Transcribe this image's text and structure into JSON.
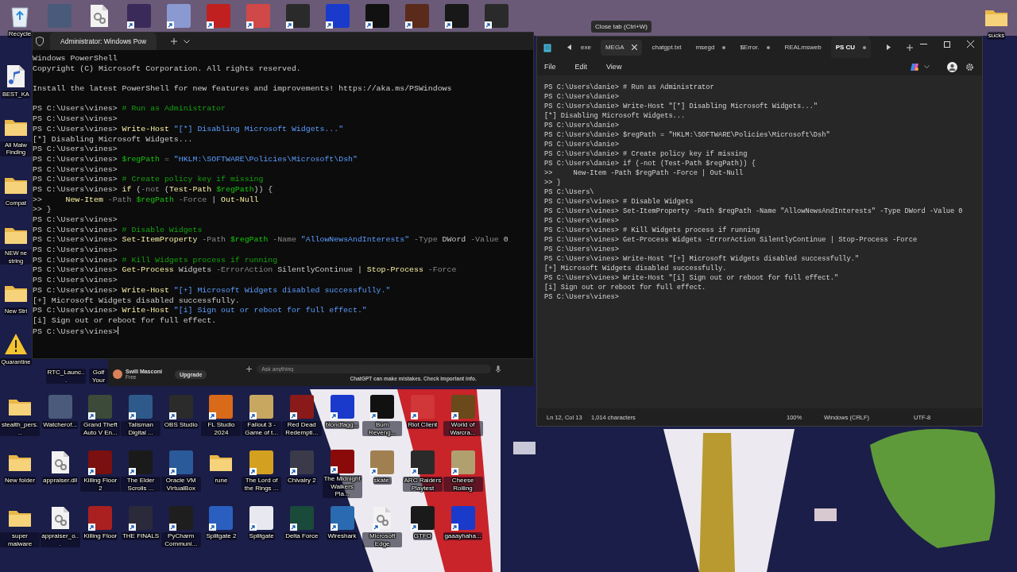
{
  "desktop": {
    "top_row": [
      {
        "label": "Recycle",
        "kind": "recycle"
      },
      {
        "kind": "app",
        "color": "#4a5a7a"
      },
      {
        "kind": "file"
      },
      {
        "kind": "app",
        "shortcut": true,
        "color": "#3a2a5a"
      },
      {
        "kind": "app",
        "shortcut": true,
        "color": "#8a9ad0"
      },
      {
        "kind": "app",
        "shortcut": true,
        "color": "#c02020"
      },
      {
        "kind": "app",
        "shortcut": true,
        "color": "#d04848"
      },
      {
        "kind": "app",
        "shortcut": true,
        "color": "#2a2a2a"
      },
      {
        "kind": "app",
        "shortcut": true,
        "color": "#1a3acc"
      },
      {
        "kind": "app",
        "shortcut": true,
        "color": "#111111"
      },
      {
        "kind": "app",
        "shortcut": true,
        "color": "#5a2a1a"
      },
      {
        "kind": "app",
        "shortcut": true,
        "color": "#181818"
      },
      {
        "kind": "app",
        "shortcut": true,
        "color": "#2a2a2a"
      }
    ],
    "left_column": [
      {
        "label": "BEST_KA",
        "kind": "music"
      },
      {
        "label": "All Malw Finding",
        "kind": "folder"
      },
      {
        "label": "Compat",
        "kind": "folder"
      },
      {
        "label": "NEW ne string",
        "kind": "folder"
      },
      {
        "label": "New Stri",
        "kind": "folder"
      },
      {
        "label": "Quarantine",
        "kind": "warning"
      }
    ],
    "partial_labels": [
      "RTC_Launc...",
      "Golf Your"
    ],
    "right_column": [
      {
        "label": "sucks",
        "kind": "folder"
      }
    ],
    "grid": [
      {
        "label": "stealth_pers...",
        "kind": "folder"
      },
      {
        "label": "Watcherof...",
        "kind": "app",
        "color": "#4a5a7a"
      },
      {
        "label": "Grand Theft Auto V En...",
        "kind": "app",
        "shortcut": true,
        "color": "#3c4a3a"
      },
      {
        "label": "Talisman Digital ...",
        "kind": "app",
        "shortcut": true,
        "color": "#2d5a8a"
      },
      {
        "label": "OBS Studio",
        "kind": "app",
        "shortcut": true,
        "color": "#2b2b2b"
      },
      {
        "label": "FL Studio 2024",
        "kind": "app",
        "shortcut": true,
        "color": "#d96a1a"
      },
      {
        "label": "Fallout 3 - Game of t...",
        "kind": "app",
        "shortcut": true,
        "color": "#c8a860"
      },
      {
        "label": "Red Dead Redempti...",
        "kind": "app",
        "shortcut": true,
        "color": "#8a1a1a"
      },
      {
        "label": "blondfagg...",
        "kind": "app",
        "shortcut": true,
        "color": "#1a3acc"
      },
      {
        "label": "Bum Reveng...",
        "kind": "app",
        "shortcut": true,
        "color": "#111111"
      },
      {
        "label": "Riot Client",
        "kind": "app",
        "shortcut": true,
        "color": "#d13639"
      },
      {
        "label": "World of Warcra...",
        "kind": "app",
        "shortcut": true,
        "color": "#6a4a1a"
      },
      {
        "label": "New folder",
        "kind": "folder"
      },
      {
        "label": "appraiser.dll",
        "kind": "file"
      },
      {
        "label": "Killing Floor 2",
        "kind": "app",
        "shortcut": true,
        "color": "#7a1010"
      },
      {
        "label": "The Elder Scrolls ...",
        "kind": "app",
        "shortcut": true,
        "color": "#1a1a1a"
      },
      {
        "label": "Oracle VM VirtualBox",
        "kind": "app",
        "shortcut": true,
        "color": "#2a5a9a"
      },
      {
        "label": "rune",
        "kind": "folder"
      },
      {
        "label": "The Lord of the Rings ...",
        "kind": "app",
        "shortcut": true,
        "color": "#d4a020"
      },
      {
        "label": "Chivalry 2",
        "kind": "app",
        "shortcut": true,
        "color": "#3a3a4a"
      },
      {
        "label": "The Midnight Walkers Pla...",
        "kind": "app",
        "shortcut": true,
        "color": "#8a0a0a"
      },
      {
        "label": "skate.",
        "kind": "app",
        "shortcut": true,
        "color": "#a08050"
      },
      {
        "label": "ARC Raiders Playtest",
        "kind": "app",
        "shortcut": true,
        "color": "#2a2a2a"
      },
      {
        "label": "Cheese Rolling",
        "kind": "app",
        "shortcut": true,
        "color": "#b0a070"
      },
      {
        "label": "super malware",
        "kind": "folder"
      },
      {
        "label": "appraiser_o...",
        "kind": "file"
      },
      {
        "label": "Killing Floor",
        "kind": "app",
        "shortcut": true,
        "color": "#aa2020"
      },
      {
        "label": "THE FINALS",
        "kind": "app",
        "shortcut": true,
        "color": "#2a2a3a"
      },
      {
        "label": "PyCharm Communi...",
        "kind": "app",
        "shortcut": true,
        "color": "#1e1e1e"
      },
      {
        "label": "Splitgate 2",
        "kind": "app",
        "shortcut": true,
        "color": "#2a5fc0"
      },
      {
        "label": "Splitgate",
        "kind": "app",
        "shortcut": true,
        "color": "#e8e8f0"
      },
      {
        "label": "Delta Force",
        "kind": "app",
        "shortcut": true,
        "color": "#1a4a3a"
      },
      {
        "label": "Wireshark",
        "kind": "app",
        "shortcut": true,
        "color": "#2a6ab0"
      },
      {
        "label": "Microsoft Edge",
        "kind": "file",
        "shortcut": true
      },
      {
        "label": "GTFO",
        "kind": "app",
        "shortcut": true,
        "color": "#1a1a1a"
      },
      {
        "label": "gaaayhaha...",
        "kind": "app",
        "shortcut": true,
        "color": "#1a3acc"
      }
    ]
  },
  "terminal": {
    "tab_title": "Administrator: Windows Pow",
    "cursor": true,
    "lines": [
      {
        "kind": "code",
        "segments": [
          {
            "kind": "text",
            "text": "Windows PowerShell"
          }
        ]
      },
      {
        "kind": "code",
        "segments": [
          {
            "kind": "text",
            "text": "Copyright (C) Microsoft Corporation. All rights reserved."
          }
        ]
      },
      {
        "kind": "blank"
      },
      {
        "kind": "code",
        "segments": [
          {
            "kind": "text",
            "text": "Install the latest PowerShell for new features and improvements! https://aka.ms/PSWindows"
          }
        ]
      },
      {
        "kind": "blank"
      },
      {
        "kind": "code",
        "segments": [
          {
            "kind": "prompt",
            "text": "PS C:\\Users\\vines> "
          },
          {
            "kind": "comment",
            "text": "# Run as Administrator"
          }
        ]
      },
      {
        "kind": "code",
        "segments": [
          {
            "kind": "prompt",
            "text": "PS C:\\Users\\vines>"
          }
        ]
      },
      {
        "kind": "code",
        "segments": [
          {
            "kind": "prompt",
            "text": "PS C:\\Users\\vines> "
          },
          {
            "kind": "cmd",
            "text": "Write-Host"
          },
          {
            "kind": "string",
            "text": " \"[*] Disabling Microsoft Widgets...\""
          }
        ]
      },
      {
        "kind": "code",
        "segments": [
          {
            "kind": "text",
            "text": "[*] Disabling Microsoft Widgets..."
          }
        ]
      },
      {
        "kind": "code",
        "segments": [
          {
            "kind": "prompt",
            "text": "PS C:\\Users\\vines>"
          }
        ]
      },
      {
        "kind": "code",
        "segments": [
          {
            "kind": "prompt",
            "text": "PS C:\\Users\\vines> "
          },
          {
            "kind": "var",
            "text": "$regPath"
          },
          {
            "kind": "param",
            "text": " = "
          },
          {
            "kind": "string",
            "text": "\"HKLM:\\SOFTWARE\\Policies\\Microsoft\\Dsh\""
          }
        ]
      },
      {
        "kind": "code",
        "segments": [
          {
            "kind": "prompt",
            "text": "PS C:\\Users\\vines>"
          }
        ]
      },
      {
        "kind": "code",
        "segments": [
          {
            "kind": "prompt",
            "text": "PS C:\\Users\\vines> "
          },
          {
            "kind": "comment",
            "text": "# Create policy key if missing"
          }
        ]
      },
      {
        "kind": "code",
        "segments": [
          {
            "kind": "prompt",
            "text": "PS C:\\Users\\vines> "
          },
          {
            "kind": "cmd",
            "text": "if"
          },
          {
            "kind": "text",
            "text": " ("
          },
          {
            "kind": "param",
            "text": "-not"
          },
          {
            "kind": "text",
            "text": " ("
          },
          {
            "kind": "cmd",
            "text": "Test-Path"
          },
          {
            "kind": "var",
            "text": " $regPath"
          },
          {
            "kind": "text",
            "text": ")) {"
          }
        ]
      },
      {
        "kind": "code",
        "segments": [
          {
            "kind": "text",
            "text": ">>     "
          },
          {
            "kind": "cmd",
            "text": "New-Item"
          },
          {
            "kind": "param",
            "text": " -Path"
          },
          {
            "kind": "var",
            "text": " $regPath"
          },
          {
            "kind": "param",
            "text": " -Force"
          },
          {
            "kind": "text",
            "text": " | "
          },
          {
            "kind": "cmd",
            "text": "Out-Null"
          }
        ]
      },
      {
        "kind": "code",
        "segments": [
          {
            "kind": "text",
            "text": ">> }"
          }
        ]
      },
      {
        "kind": "code",
        "segments": [
          {
            "kind": "prompt",
            "text": "PS C:\\Users\\vines>"
          }
        ]
      },
      {
        "kind": "code",
        "segments": [
          {
            "kind": "prompt",
            "text": "PS C:\\Users\\vines> "
          },
          {
            "kind": "comment",
            "text": "# Disable Widgets"
          }
        ]
      },
      {
        "kind": "code",
        "segments": [
          {
            "kind": "prompt",
            "text": "PS C:\\Users\\vines> "
          },
          {
            "kind": "cmd",
            "text": "Set-ItemProperty"
          },
          {
            "kind": "param",
            "text": " -Path"
          },
          {
            "kind": "var",
            "text": " $regPath"
          },
          {
            "kind": "param",
            "text": " -Name"
          },
          {
            "kind": "string",
            "text": " \"AllowNewsAndInterests\""
          },
          {
            "kind": "param",
            "text": " -Type"
          },
          {
            "kind": "text",
            "text": " DWord"
          },
          {
            "kind": "param",
            "text": " -Value"
          },
          {
            "kind": "text",
            "text": " 0"
          }
        ]
      },
      {
        "kind": "code",
        "segments": [
          {
            "kind": "prompt",
            "text": "PS C:\\Users\\vines>"
          }
        ]
      },
      {
        "kind": "code",
        "segments": [
          {
            "kind": "prompt",
            "text": "PS C:\\Users\\vines> "
          },
          {
            "kind": "comment",
            "text": "# Kill Widgets process if running"
          }
        ]
      },
      {
        "kind": "code",
        "segments": [
          {
            "kind": "prompt",
            "text": "PS C:\\Users\\vines> "
          },
          {
            "kind": "cmd",
            "text": "Get-Process"
          },
          {
            "kind": "text",
            "text": " Widgets "
          },
          {
            "kind": "param",
            "text": "-ErrorAction"
          },
          {
            "kind": "text",
            "text": " SilentlyContinue | "
          },
          {
            "kind": "cmd",
            "text": "Stop-Process"
          },
          {
            "kind": "param",
            "text": " -Force"
          }
        ]
      },
      {
        "kind": "code",
        "segments": [
          {
            "kind": "prompt",
            "text": "PS C:\\Users\\vines>"
          }
        ]
      },
      {
        "kind": "code",
        "segments": [
          {
            "kind": "prompt",
            "text": "PS C:\\Users\\vines> "
          },
          {
            "kind": "cmd",
            "text": "Write-Host"
          },
          {
            "kind": "string",
            "text": " \"[+] Microsoft Widgets disabled successfully.\""
          }
        ]
      },
      {
        "kind": "code",
        "segments": [
          {
            "kind": "text",
            "text": "[+] Microsoft Widgets disabled successfully."
          }
        ]
      },
      {
        "kind": "code",
        "segments": [
          {
            "kind": "prompt",
            "text": "PS C:\\Users\\vines> "
          },
          {
            "kind": "cmd",
            "text": "Write-Host"
          },
          {
            "kind": "string",
            "text": " \"[i] Sign out or reboot for full effect.\""
          }
        ]
      },
      {
        "kind": "code",
        "segments": [
          {
            "kind": "text",
            "text": "[i] Sign out or reboot for full effect."
          }
        ]
      },
      {
        "kind": "code",
        "segments": [
          {
            "kind": "prompt",
            "text": "PS C:\\Users\\vines>"
          }
        ]
      }
    ]
  },
  "chatgpt": {
    "user_name": "Swill Masconi",
    "plan": "Free",
    "upgrade": "Upgrade",
    "placeholder": "Ask anything",
    "disclaimer": "ChatGPT can make mistakes. Check important info."
  },
  "tooltip": "Close tab (Ctrl+W)",
  "notepad": {
    "tabs": [
      {
        "label": "exe",
        "selected": false,
        "modified": false,
        "hovered": false
      },
      {
        "label": "MEGA",
        "selected": false,
        "modified": false,
        "hovered": true
      },
      {
        "label": "chatgpt.txt",
        "selected": false,
        "modified": false,
        "hovered": false
      },
      {
        "label": "msegd",
        "selected": false,
        "modified": true,
        "hovered": false
      },
      {
        "label": "$Error.",
        "selected": false,
        "modified": true,
        "hovered": false
      },
      {
        "label": "REALmsweb",
        "selected": false,
        "modified": false,
        "hovered": false
      },
      {
        "label": "PS CU",
        "selected": true,
        "modified": true,
        "hovered": false
      }
    ],
    "menu": [
      "File",
      "Edit",
      "View"
    ],
    "lines": [
      "PS C:\\Users\\danie> # Run as Administrator",
      "PS C:\\Users\\danie>",
      "PS C:\\Users\\danie> Write-Host \"[*] Disabling Microsoft Widgets...\"",
      "[*] Disabling Microsoft Widgets...",
      "PS C:\\Users\\danie>",
      "PS C:\\Users\\danie> $regPath = \"HKLM:\\SOFTWARE\\Policies\\Microsoft\\Dsh\"",
      "PS C:\\Users\\danie>",
      "PS C:\\Users\\danie> # Create policy key if missing",
      "PS C:\\Users\\danie> if (-not (Test-Path $regPath)) {",
      ">>     New-Item -Path $regPath -Force | Out-Null",
      ">> }",
      "PS C:\\Users\\",
      "PS C:\\Users\\vines> # Disable Widgets",
      "PS C:\\Users\\vines> Set-ItemProperty -Path $regPath -Name \"AllowNewsAndInterests\" -Type DWord -Value 0",
      "PS C:\\Users\\vines>",
      "PS C:\\Users\\vines> # Kill Widgets process if running",
      "PS C:\\Users\\vines> Get-Process Widgets -ErrorAction SilentlyContinue | Stop-Process -Force",
      "PS C:\\Users\\vines>",
      "PS C:\\Users\\vines> Write-Host \"[+] Microsoft Widgets disabled successfully.\"",
      "[+] Microsoft Widgets disabled successfully.",
      "PS C:\\Users\\vines> Write-Host \"[i] Sign out or reboot for full effect.\"",
      "[i] Sign out or reboot for full effect.",
      "PS C:\\Users\\vines>"
    ],
    "status": {
      "position": "Ln 12, Col 13",
      "characters": "1,014 characters",
      "zoom": "100%",
      "line_ending": "Windows (CRLF)",
      "encoding": "UTF-8"
    }
  }
}
